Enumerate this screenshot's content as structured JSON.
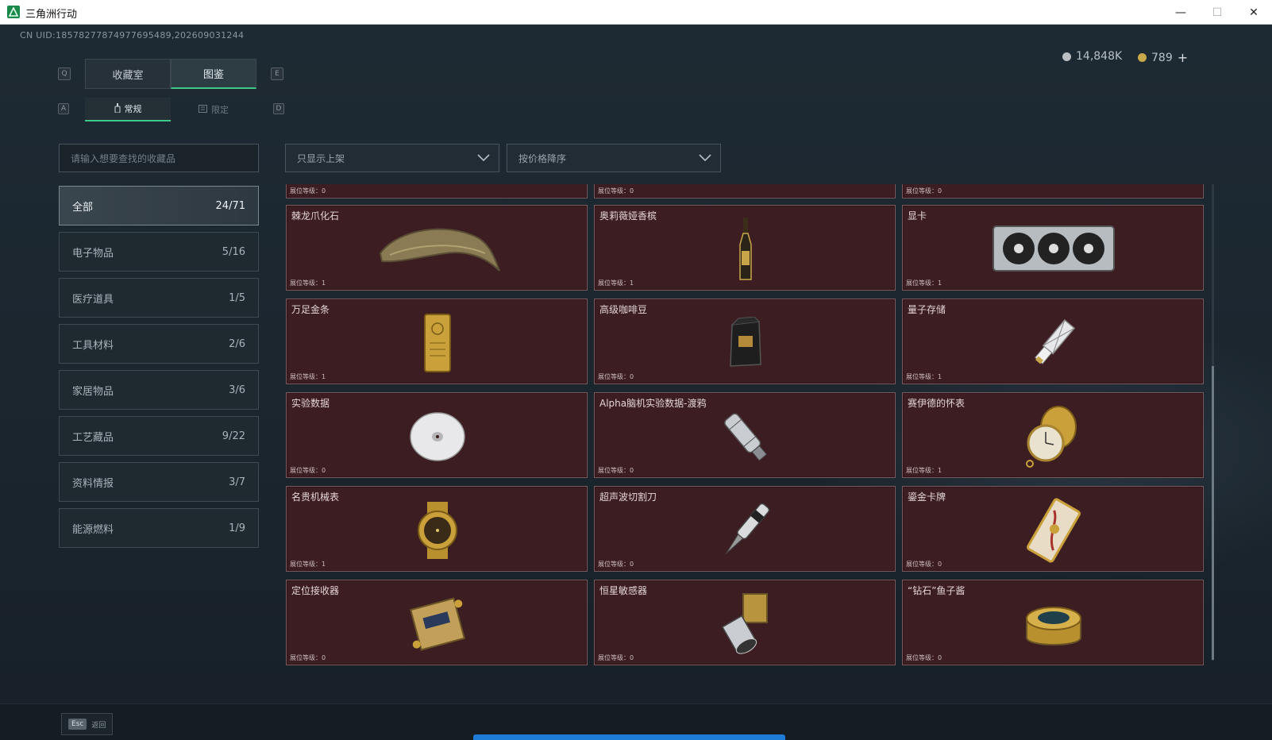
{
  "window": {
    "title": "三角洲行动"
  },
  "header": {
    "uid": "CN UID:18578277874977695489,202609031244"
  },
  "currency": [
    {
      "value": "14,848K",
      "color": "#b9bfc3"
    },
    {
      "value": "789",
      "plus": "+",
      "color": "#c8a84a"
    }
  ],
  "keys": {
    "q": "Q",
    "e": "E",
    "a": "A",
    "d": "D"
  },
  "tabs": {
    "collection": "收藏室",
    "catalog": "图鉴"
  },
  "subtabs": {
    "regular": "常规",
    "limited": "限定"
  },
  "search": {
    "placeholder": "请输入想要查找的收藏品"
  },
  "filters": {
    "shelf": "只显示上架",
    "sort": "按价格降序"
  },
  "categories": [
    {
      "name": "全部",
      "count": "24/71"
    },
    {
      "name": "电子物品",
      "count": "5/16"
    },
    {
      "name": "医疗道具",
      "count": "1/5"
    },
    {
      "name": "工具材料",
      "count": "2/6"
    },
    {
      "name": "家居物品",
      "count": "3/6"
    },
    {
      "name": "工艺藏品",
      "count": "9/22"
    },
    {
      "name": "资料情报",
      "count": "3/7"
    },
    {
      "name": "能源燃料",
      "count": "1/9"
    }
  ],
  "partial_row": [
    {
      "level": "展位等级：0"
    },
    {
      "level": "展位等级：0"
    },
    {
      "level": "展位等级：0"
    }
  ],
  "items": [
    {
      "name": "棘龙爪化石",
      "level": "展位等级：1",
      "icon": "claw-fossil-icon"
    },
    {
      "name": "奥莉薇娅香槟",
      "level": "展位等级：1",
      "icon": "champagne-icon"
    },
    {
      "name": "显卡",
      "level": "展位等级：1",
      "icon": "graphics-card-icon"
    },
    {
      "name": "万足金条",
      "level": "展位等级：1",
      "icon": "gold-bar-icon"
    },
    {
      "name": "高级咖啡豆",
      "level": "展位等级：0",
      "icon": "coffee-bag-icon"
    },
    {
      "name": "量子存储",
      "level": "展位等级：1",
      "icon": "quantum-storage-icon"
    },
    {
      "name": "实验数据",
      "level": "展位等级：0",
      "icon": "disc-icon"
    },
    {
      "name": "Alpha脑机实验数据-渡鸦",
      "level": "展位等级：0",
      "icon": "data-canister-icon"
    },
    {
      "name": "赛伊德的怀表",
      "level": "展位等级：1",
      "icon": "pocket-watch-icon"
    },
    {
      "name": "名贵机械表",
      "level": "展位等级：1",
      "icon": "wristwatch-icon"
    },
    {
      "name": "超声波切割刀",
      "level": "展位等级：0",
      "icon": "ultrasonic-cutter-icon"
    },
    {
      "name": "鎏金卡牌",
      "level": "展位等级：0",
      "icon": "gilded-card-icon"
    },
    {
      "name": "定位接收器",
      "level": "展位等级：0",
      "icon": "locator-receiver-icon"
    },
    {
      "name": "恒星敏感器",
      "level": "展位等级：0",
      "icon": "star-sensor-icon"
    },
    {
      "name": "“钻石”鱼子酱",
      "level": "展位等级：0",
      "icon": "caviar-tin-icon"
    }
  ],
  "footer": {
    "esc_key": "Esc",
    "back": "返回"
  },
  "colors": {
    "accent": "#3ec88a",
    "card_bg": "#3c1e22",
    "card_border": "#7a5a5d"
  }
}
